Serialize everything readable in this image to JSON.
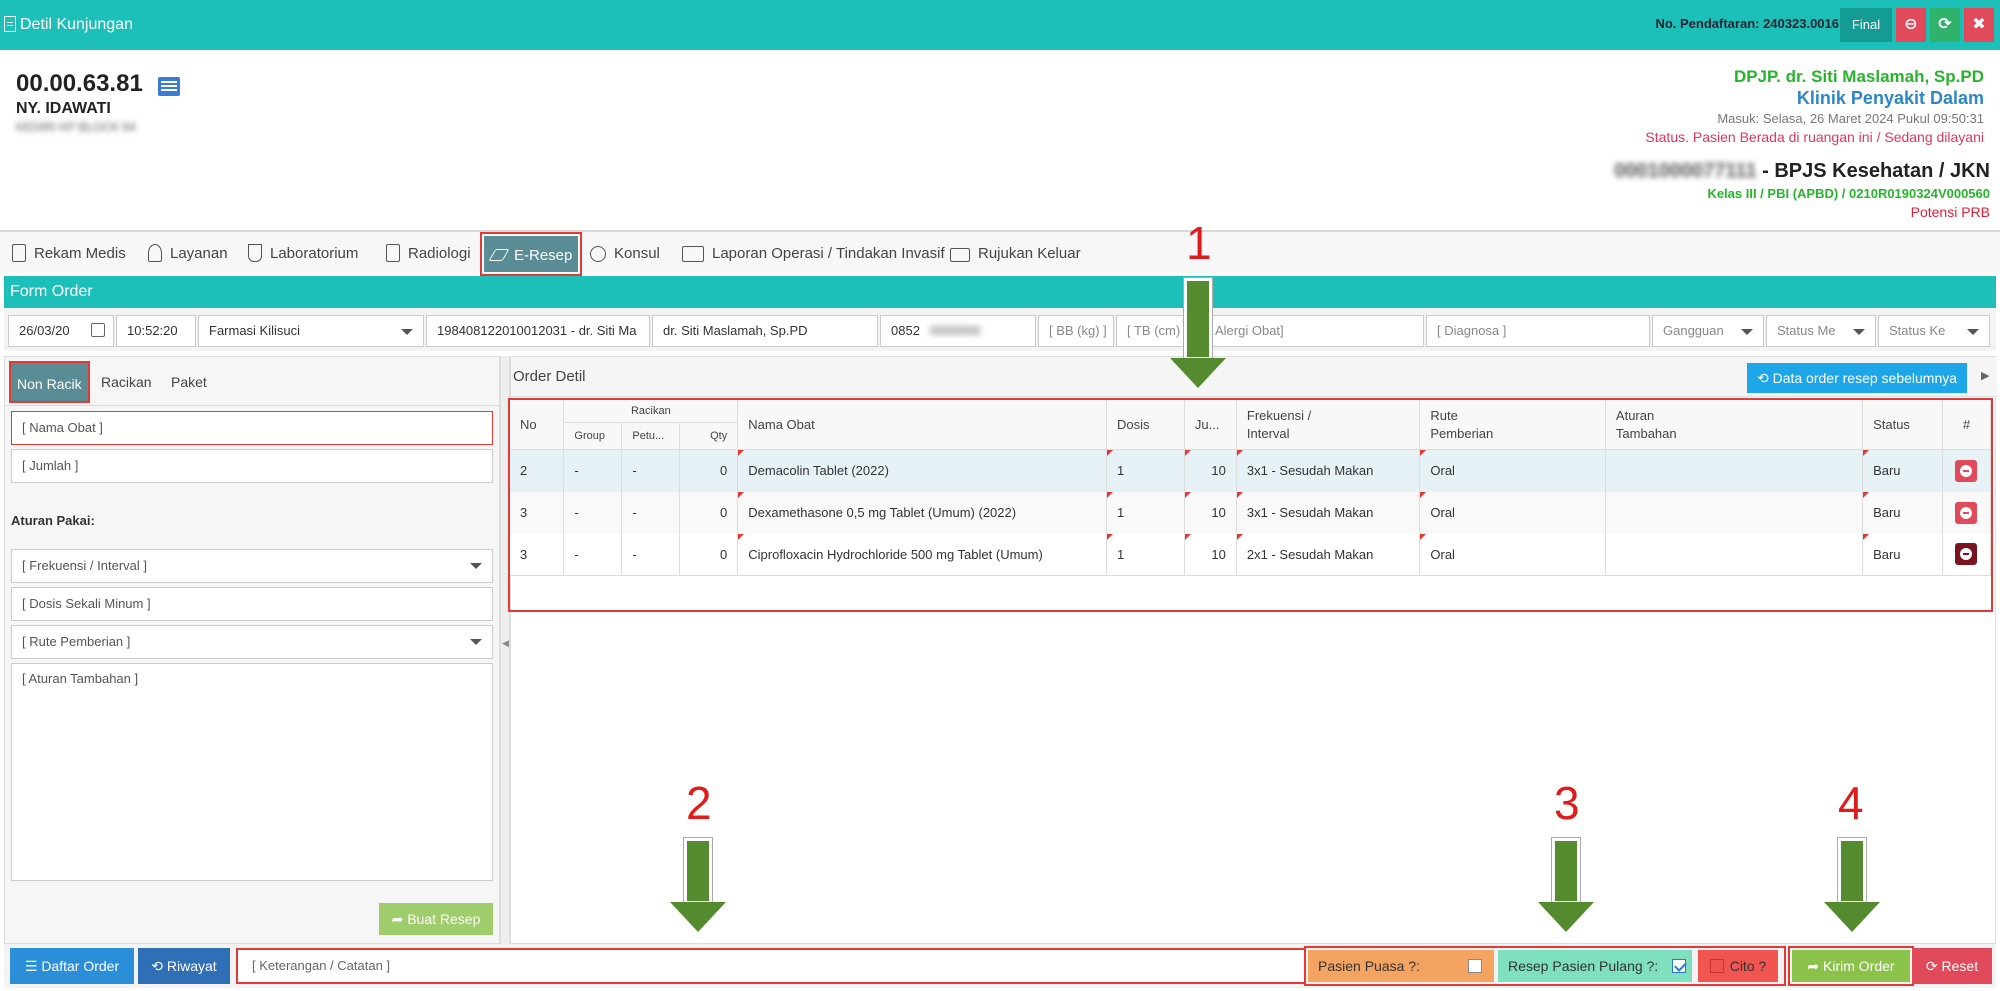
{
  "topbar": {
    "title": "Detil Kunjungan",
    "no_pendaftaran": "No. Pendaftaran: 240323.0016",
    "final_label": "Final",
    "bg_color": "#1dc0b8"
  },
  "patient": {
    "id": "00.00.63.81",
    "name": "NY. IDAWATI",
    "address_blurred": "KEDIRI KP BLOCK 64"
  },
  "visit": {
    "dpjp": "DPJP. dr. Siti Maslamah, Sp.PD",
    "klinik": "Klinik Penyakit Dalam",
    "masuk": "Masuk: Selasa, 26 Maret 2024 Pukul 09:50:31",
    "status": "Status. Pasien Berada di ruangan ini / Sedang dilayani",
    "insurance_blurred": "0001000077111",
    "insurance": " - BPJS Kesehatan / JKN",
    "kelas": "Kelas III / PBI (APBD) / 0210R0190324V000560",
    "potensi": "Potensi PRB"
  },
  "tabs": [
    {
      "label": "Rekam Medis",
      "icon": "document-icon"
    },
    {
      "label": "Layanan",
      "icon": "doctor-icon"
    },
    {
      "label": "Laboratorium",
      "icon": "flask-icon"
    },
    {
      "label": "Radiologi",
      "icon": "xray-icon"
    },
    {
      "label": "E-Resep",
      "icon": "eraser-icon",
      "active": true
    },
    {
      "label": "Konsul",
      "icon": "wheelchair-icon"
    },
    {
      "label": "Laporan Operasi / Tindakan Invasif",
      "icon": "report-icon"
    },
    {
      "label": "Rujukan Keluar",
      "icon": "envelope-icon"
    }
  ],
  "form_order": {
    "title": "Form Order",
    "date": "26/03/20",
    "time": "10:52:20",
    "farmasi": "Farmasi Kilisuci",
    "nip": "198408122010012031 - dr. Siti Ma",
    "doctor": "dr. Siti Maslamah, Sp.PD",
    "phone": "0852",
    "bb_placeholder": "[ BB (kg) ]",
    "tb_placeholder": "[ TB (cm)",
    "alergi_placeholder": "Alergi Obat]",
    "diagnosa_placeholder": "[ Diagnosa ]",
    "gangguan": "Gangguan",
    "status_m": "Status Me",
    "status_k": "Status Ke"
  },
  "left": {
    "subtabs": [
      "Non Racik",
      "Racikan",
      "Paket"
    ],
    "nama_obat": "[ Nama Obat ]",
    "jumlah": "[ Jumlah ]",
    "aturan_label": "Aturan Pakai:",
    "frekuensi": "[ Frekuensi / Interval ]",
    "dosis": "[ Dosis Sekali Minum ]",
    "rute": "[ Rute Pemberian ]",
    "aturan_tambahan": "[ Aturan Tambahan ]",
    "buat_resep": "Buat Resep"
  },
  "order_detil": {
    "title": "Order Detil",
    "data_order_btn": "Data order resep sebelumnya",
    "headers": {
      "no": "No",
      "racikan": "Racikan",
      "group": "Group",
      "petu": "Petu...",
      "qty": "Qty",
      "nama_obat": "Nama Obat",
      "dosis": "Dosis",
      "ju": "Ju...",
      "frekuensi_1": "Frekuensi /",
      "frekuensi_2": "Interval",
      "rute_1": "Rute",
      "rute_2": "Pemberian",
      "aturan_1": "Aturan",
      "aturan_2": "Tambahan",
      "status": "Status",
      "hash": "#"
    },
    "rows": [
      {
        "no": "2",
        "group": "-",
        "petu": "-",
        "qty": "0",
        "nama": "Demacolin Tablet (2022)",
        "dosis": "1",
        "jumlah": "10",
        "frekuensi": "3x1 - Sesudah Makan",
        "rute": "Oral",
        "aturan": "",
        "status": "Baru"
      },
      {
        "no": "3",
        "group": "-",
        "petu": "-",
        "qty": "0",
        "nama": "Dexamethasone 0,5 mg Tablet (Umum) (2022)",
        "dosis": "1",
        "jumlah": "10",
        "frekuensi": "3x1 - Sesudah Makan",
        "rute": "Oral",
        "aturan": "",
        "status": "Baru"
      },
      {
        "no": "3",
        "group": "-",
        "petu": "-",
        "qty": "0",
        "nama": "Ciprofloxacin Hydrochloride 500 mg Tablet (Umum)",
        "dosis": "1",
        "jumlah": "10",
        "frekuensi": "2x1 - Sesudah Makan",
        "rute": "Oral",
        "aturan": "",
        "status": "Baru"
      }
    ]
  },
  "bottom": {
    "daftar_order": "Daftar Order",
    "riwayat": "Riwayat",
    "keterangan": "[ Keterangan / Catatan ]",
    "pasien_puasa": "Pasien Puasa ?:",
    "resep_pulang": "Resep Pasien Pulang ?:",
    "cito": "Cito ?",
    "kirim_order": "Kirim Order",
    "reset": "Reset"
  },
  "annotations": [
    "1",
    "2",
    "3",
    "4"
  ]
}
